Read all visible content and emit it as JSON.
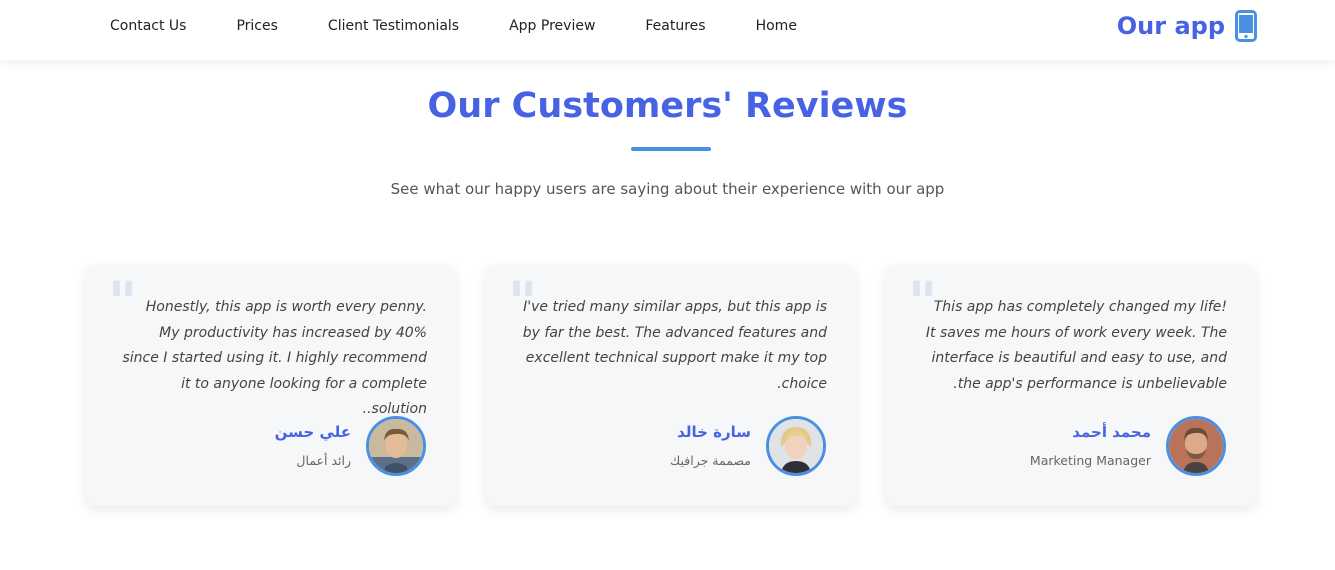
{
  "nav": {
    "links": [
      "Contact Us",
      "Prices",
      "Client Testimonials",
      "App Preview",
      "Features",
      "Home"
    ],
    "brand": "Our app",
    "brand_icon": "mobile-phone-icon"
  },
  "section": {
    "title": "Our Customers' Reviews",
    "subtitle": "See what our happy users are saying about their experience with our app"
  },
  "reviews": [
    {
      "text": "Honestly, this app is worth every penny. My productivity has increased by 40% since I started using it. I highly recommend it to anyone looking for a complete solution..",
      "name": "علي حسن",
      "role": "رائد أعمال"
    },
    {
      "text": "I've tried many similar apps, but this app is by far the best. The advanced features and excellent technical support make it my top choice.",
      "name": "سارة خالد",
      "role": "مصممة جرافيك"
    },
    {
      "text": "This app has completely changed my life! It saves me hours of work every week. The interface is beautiful and easy to use, and the app's performance is unbelievable.",
      "name": "محمد أحمد",
      "role": "Marketing Manager"
    }
  ],
  "colors": {
    "accent": "#4763e4",
    "underline": "#4a90e2",
    "card_bg": "#f6f7f9",
    "quote": "#dde4f1"
  }
}
